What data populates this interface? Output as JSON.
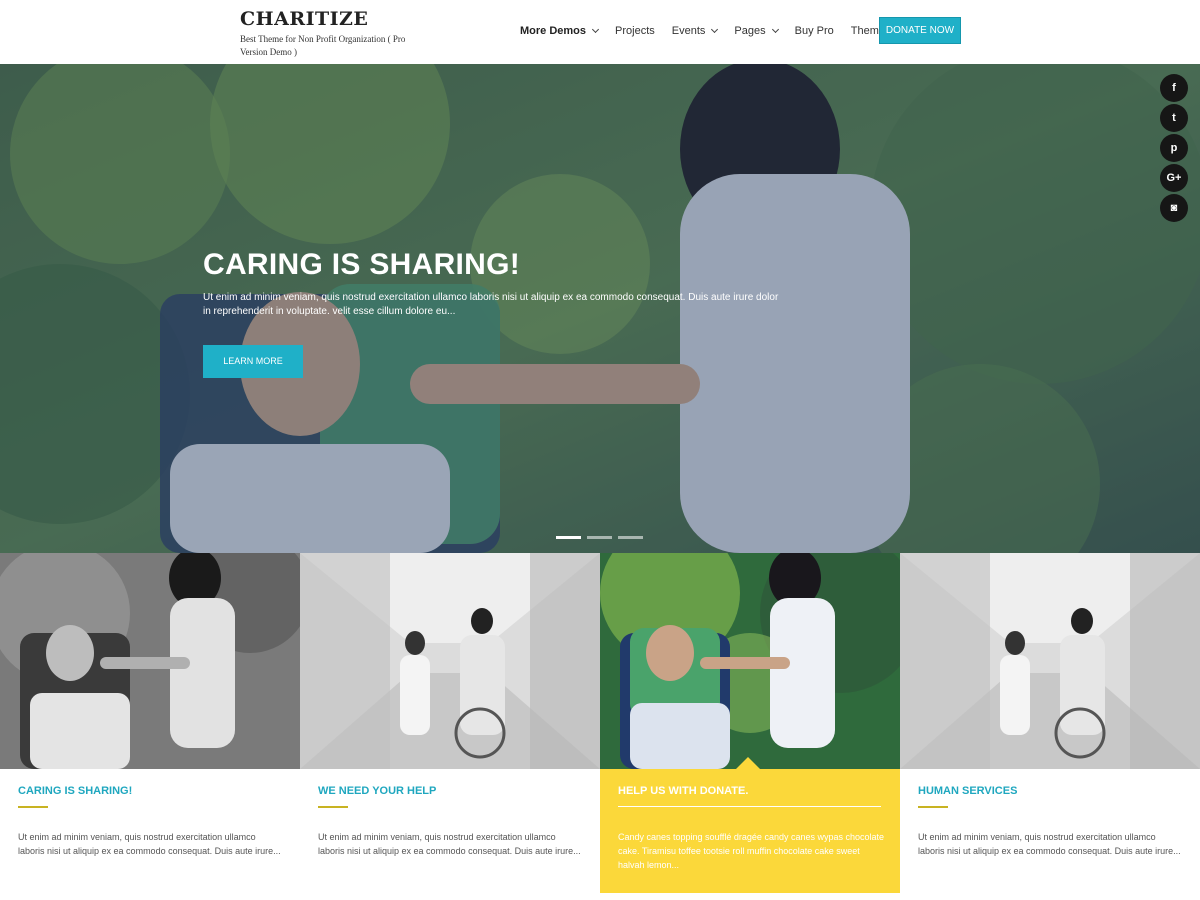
{
  "header": {
    "brand_title": "CHARITIZE",
    "brand_subtitle": "Best Theme for Non Profit Organization ( Pro Version Demo )",
    "nav": [
      {
        "label": "More Demos",
        "dropdown": true
      },
      {
        "label": "Projects",
        "dropdown": false
      },
      {
        "label": "Events",
        "dropdown": true
      },
      {
        "label": "Pages",
        "dropdown": true
      },
      {
        "label": "Buy Pro",
        "dropdown": false
      },
      {
        "label": "Themes",
        "dropdown": true
      }
    ],
    "donate_label": "DONATE NOW"
  },
  "hero": {
    "title": "CARING IS SHARING!",
    "text": "Ut enim ad minim veniam, quis nostrud exercitation ullamco laboris nisi ut aliquip ex ea commodo consequat. Duis aute irure dolor in reprehenderit in voluptate. velit esse cillum dolore eu...",
    "button_label": "LEARN MORE",
    "slide_count": 3,
    "active_slide": 1
  },
  "social": [
    {
      "icon": "facebook-icon",
      "glyph": "f"
    },
    {
      "icon": "twitter-icon",
      "glyph": "t"
    },
    {
      "icon": "pinterest-icon",
      "glyph": "p"
    },
    {
      "icon": "google-plus-icon",
      "glyph": "G+"
    },
    {
      "icon": "instagram-icon",
      "glyph": "◙"
    }
  ],
  "cards": [
    {
      "title": "CARING IS SHARING!",
      "text": "Ut enim ad minim veniam, quis nostrud exercitation ullamco laboris nisi ut aliquip ex ea commodo consequat. Duis aute irure...",
      "featured": false
    },
    {
      "title": "WE NEED YOUR HELP",
      "text": "Ut enim ad minim veniam, quis nostrud exercitation ullamco laboris nisi ut aliquip ex ea commodo consequat. Duis aute irure...",
      "featured": false
    },
    {
      "title": "HELP US WITH DONATE.",
      "text": "Candy canes topping soufflé dragée candy canes wypas chocolate cake. Tiramisu toffee tootsie roll muffin chocolate cake sweet halvah lemon...",
      "featured": true
    },
    {
      "title": "HUMAN SERVICES",
      "text": "Ut enim ad minim veniam, quis nostrud exercitation ullamco laboris nisi ut aliquip ex ea commodo consequat. Duis aute irure...",
      "featured": false
    }
  ],
  "colors": {
    "accent": "#1fb0c8",
    "featured": "#fbd83a",
    "dark": "#161616"
  }
}
